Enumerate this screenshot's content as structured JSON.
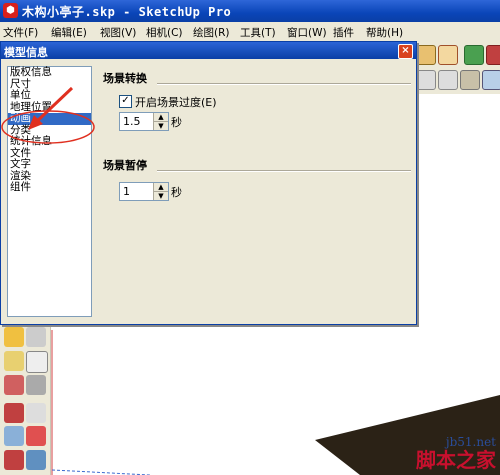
{
  "window": {
    "title": "木构小亭子.skp - SketchUp Pro"
  },
  "menu": [
    "文件(F)",
    "编辑(E)",
    "视图(V)",
    "相机(C)",
    "绘图(R)",
    "工具(T)",
    "窗口(W)",
    "插件",
    "帮助(H)"
  ],
  "dialog": {
    "title": "模型信息",
    "close": "×",
    "categories": [
      "版权信息",
      "尺寸",
      "单位",
      "地理位置",
      "动画",
      "分类",
      "统计信息",
      "文件",
      "文字",
      "渲染",
      "组件"
    ],
    "selected_index": 4,
    "scene_transition": {
      "heading": "场景转换",
      "enable_label": "开启场景过度(E)",
      "enabled": true,
      "duration": "1.5",
      "unit": "秒"
    },
    "scene_delay": {
      "heading": "场景暂停",
      "duration": "1",
      "unit": "秒"
    }
  },
  "watermark": {
    "url": "jb51.net",
    "site": "脚本之家"
  },
  "colors": {
    "titlebar": "#0a45b8",
    "selection": "#316ac5",
    "annotation": "#e03020"
  },
  "icons": [
    "sketchup-logo-icon",
    "close-icon",
    "checkmark-icon",
    "spin-up-icon",
    "spin-down-icon",
    "red-arrow-annotation-icon"
  ]
}
